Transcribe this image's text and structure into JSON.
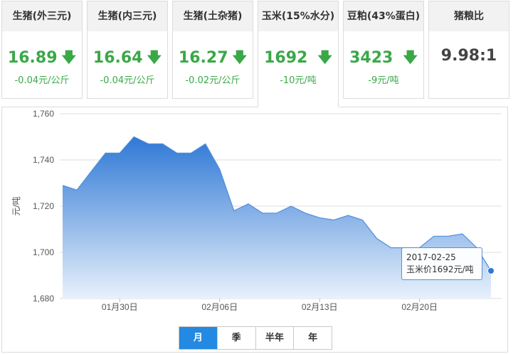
{
  "cards": [
    {
      "title": "生猪(外三元)",
      "price": "16.89",
      "change": "-0.04元/公斤",
      "trend": "down",
      "arrow": "🡇"
    },
    {
      "title": "生猪(内三元)",
      "price": "16.64",
      "change": "-0.04元/公斤",
      "trend": "down",
      "arrow": "🡇"
    },
    {
      "title": "生猪(土杂猪)",
      "price": "16.27",
      "change": "-0.02元/公斤",
      "trend": "down",
      "arrow": "🡇"
    },
    {
      "title": "玉米(15%水分)",
      "price": "1692",
      "change": "-10元/吨",
      "trend": "down",
      "arrow": "🡇",
      "active": true
    },
    {
      "title": "豆粕(43%蛋白)",
      "price": "3423",
      "change": "-9元/吨",
      "trend": "down",
      "arrow": "🡇"
    },
    {
      "title": "猪粮比",
      "price": "9.98:1",
      "change": "",
      "trend": "none",
      "arrow": ""
    }
  ],
  "colors": {
    "down": "#3aa848",
    "line": "#4f8fd9",
    "fill_top": "#2f78d6",
    "fill_bottom": "#e8f1fb",
    "grid": "#dedede",
    "tab_active": "#2489e2"
  },
  "chart_data": {
    "type": "area",
    "ylabel": "元/吨",
    "ylim": [
      1680,
      1760
    ],
    "yticks": [
      1680,
      1700,
      1720,
      1740,
      1760
    ],
    "ytick_labels": [
      "1,680",
      "1,700",
      "1,720",
      "1,740",
      "1,760"
    ],
    "x_tick_labels": [
      {
        "label": "01月30日",
        "date": "2017-01-30"
      },
      {
        "label": "02月06日",
        "date": "2017-02-06"
      },
      {
        "label": "02月13日",
        "date": "2017-02-13"
      },
      {
        "label": "02月20日",
        "date": "2017-02-20"
      }
    ],
    "x": [
      "2017-01-26",
      "2017-01-27",
      "2017-01-28",
      "2017-01-29",
      "2017-01-30",
      "2017-01-31",
      "2017-02-01",
      "2017-02-02",
      "2017-02-03",
      "2017-02-04",
      "2017-02-05",
      "2017-02-06",
      "2017-02-07",
      "2017-02-08",
      "2017-02-09",
      "2017-02-10",
      "2017-02-11",
      "2017-02-12",
      "2017-02-13",
      "2017-02-14",
      "2017-02-15",
      "2017-02-16",
      "2017-02-17",
      "2017-02-18",
      "2017-02-19",
      "2017-02-20",
      "2017-02-21",
      "2017-02-22",
      "2017-02-23",
      "2017-02-24",
      "2017-02-25"
    ],
    "values": [
      1729,
      1727,
      1735,
      1743,
      1743,
      1750,
      1747,
      1747,
      1743,
      1743,
      1747,
      1736,
      1718,
      1721,
      1717,
      1717,
      1720,
      1717,
      1715,
      1714,
      1716,
      1714,
      1706,
      1702,
      1702,
      1702,
      1707,
      1707,
      1708,
      1702,
      1692
    ],
    "grid": true,
    "legend": "none"
  },
  "tooltip": {
    "date": "2017-02-25",
    "text": "玉米价1692元/吨"
  },
  "range_tabs": [
    {
      "label": "月",
      "active": true
    },
    {
      "label": "季",
      "active": false
    },
    {
      "label": "半年",
      "active": false
    },
    {
      "label": "年",
      "active": false
    }
  ]
}
